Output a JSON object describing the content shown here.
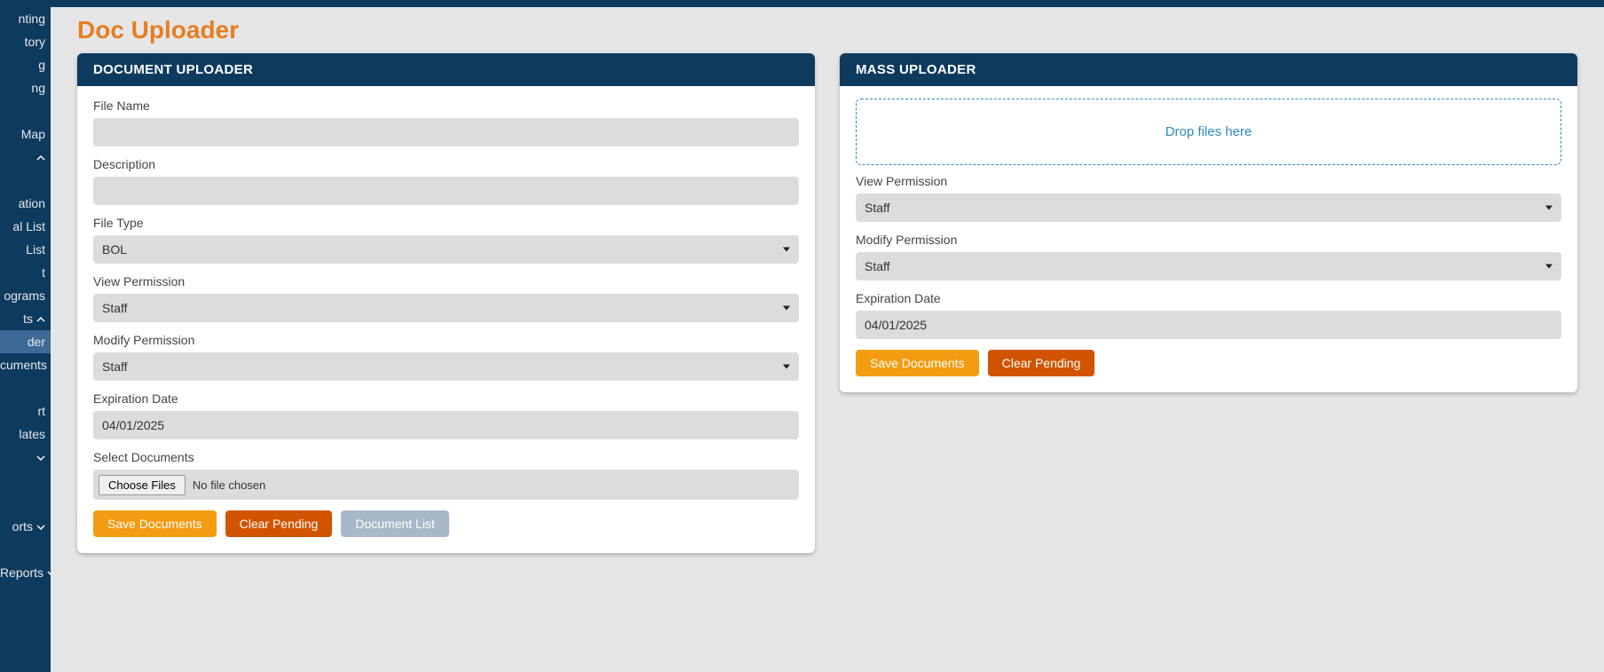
{
  "page": {
    "title": "Doc Uploader"
  },
  "sidebar": {
    "items": [
      {
        "label": "nting",
        "active": false,
        "chevron": null
      },
      {
        "label": "tory",
        "active": false,
        "chevron": null
      },
      {
        "label": "g",
        "active": false,
        "chevron": null
      },
      {
        "label": "ng",
        "active": false,
        "chevron": null
      },
      {
        "label": "",
        "active": false,
        "chevron": null
      },
      {
        "label": "Map",
        "active": false,
        "chevron": null
      },
      {
        "label": "",
        "active": false,
        "chevron": "up"
      },
      {
        "label": "",
        "active": false,
        "chevron": null
      },
      {
        "label": "ation",
        "active": false,
        "chevron": null
      },
      {
        "label": "al List",
        "active": false,
        "chevron": null
      },
      {
        "label": "List",
        "active": false,
        "chevron": null
      },
      {
        "label": "t",
        "active": false,
        "chevron": null
      },
      {
        "label": "ograms",
        "active": false,
        "chevron": null
      },
      {
        "label": "ts",
        "active": false,
        "chevron": "up"
      },
      {
        "label": "der",
        "active": true,
        "chevron": null
      },
      {
        "label": "cuments",
        "active": false,
        "chevron": null
      },
      {
        "label": "",
        "active": false,
        "chevron": null
      },
      {
        "label": "rt",
        "active": false,
        "chevron": null
      },
      {
        "label": "lates",
        "active": false,
        "chevron": null
      },
      {
        "label": "",
        "active": false,
        "chevron": "down"
      },
      {
        "label": "",
        "active": false,
        "chevron": null
      },
      {
        "label": "",
        "active": false,
        "chevron": null
      },
      {
        "label": "orts",
        "active": false,
        "chevron": "down"
      },
      {
        "label": "",
        "active": false,
        "chevron": null
      },
      {
        "label": "Reports",
        "active": false,
        "chevron": "down"
      }
    ]
  },
  "uploader": {
    "header": "DOCUMENT UPLOADER",
    "fileName": {
      "label": "File Name",
      "value": ""
    },
    "description": {
      "label": "Description",
      "value": ""
    },
    "fileType": {
      "label": "File Type",
      "value": "BOL"
    },
    "viewPermission": {
      "label": "View Permission",
      "value": "Staff"
    },
    "modifyPermission": {
      "label": "Modify Permission",
      "value": "Staff"
    },
    "expiration": {
      "label": "Expiration Date",
      "value": "04/01/2025"
    },
    "selectDocs": {
      "label": "Select Documents",
      "button": "Choose Files",
      "status": "No file chosen"
    },
    "buttons": {
      "save": "Save Documents",
      "clear": "Clear Pending",
      "list": "Document List"
    }
  },
  "mass": {
    "header": "MASS UPLOADER",
    "dropText": "Drop files here",
    "viewPermission": {
      "label": "View Permission",
      "value": "Staff"
    },
    "modifyPermission": {
      "label": "Modify Permission",
      "value": "Staff"
    },
    "expiration": {
      "label": "Expiration Date",
      "value": "04/01/2025"
    },
    "buttons": {
      "save": "Save Documents",
      "clear": "Clear Pending"
    }
  }
}
